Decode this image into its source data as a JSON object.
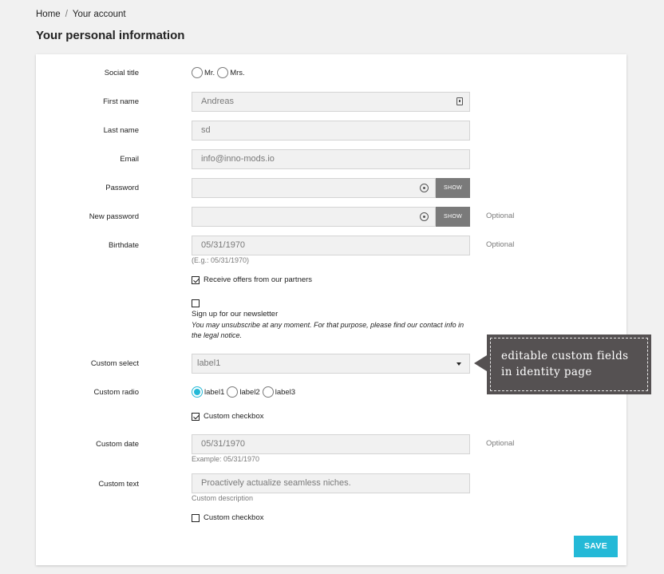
{
  "breadcrumb": {
    "home": "Home",
    "separator": "/",
    "current": "Your account"
  },
  "page_title": "Your personal information",
  "form": {
    "social_title": {
      "label": "Social title",
      "options": [
        "Mr.",
        "Mrs."
      ]
    },
    "first_name": {
      "label": "First name",
      "value": "Andreas"
    },
    "last_name": {
      "label": "Last name",
      "value": "sd"
    },
    "email": {
      "label": "Email",
      "value": "info@inno-mods.io"
    },
    "password": {
      "label": "Password",
      "value": "",
      "show_label": "SHOW"
    },
    "new_password": {
      "label": "New password",
      "value": "",
      "show_label": "SHOW",
      "optional": "Optional"
    },
    "birthdate": {
      "label": "Birthdate",
      "value": "05/31/1970",
      "hint": "(E.g.: 05/31/1970)",
      "optional": "Optional"
    },
    "partner_offers": {
      "label": "Receive offers from our partners",
      "checked": true
    },
    "newsletter": {
      "label": "Sign up for our newsletter",
      "checked": false,
      "description": "You may unsubscribe at any moment. For that purpose, please find our contact info in the legal notice."
    },
    "custom_select": {
      "label": "Custom select",
      "value": "label1"
    },
    "custom_radio": {
      "label": "Custom radio",
      "options": [
        "label1",
        "label2",
        "label3"
      ],
      "selected": "label1"
    },
    "custom_checkbox_1": {
      "label": "Custom checkbox",
      "checked": true
    },
    "custom_date": {
      "label": "Custom date",
      "value": "05/31/1970",
      "hint": "Example: 05/31/1970",
      "optional": "Optional"
    },
    "custom_text": {
      "label": "Custom text",
      "value": "Proactively actualize seamless niches.",
      "hint": "Custom description"
    },
    "custom_checkbox_2": {
      "label": "Custom checkbox",
      "checked": false
    },
    "save_label": "SAVE"
  },
  "tooltip": {
    "line1": "editable custom fields",
    "line2": "in identity page"
  },
  "colors": {
    "accent": "#24b9d7",
    "tooltip_bg": "#555152",
    "field_bg": "#f1f1f1",
    "show_button": "#7a7a7a"
  }
}
